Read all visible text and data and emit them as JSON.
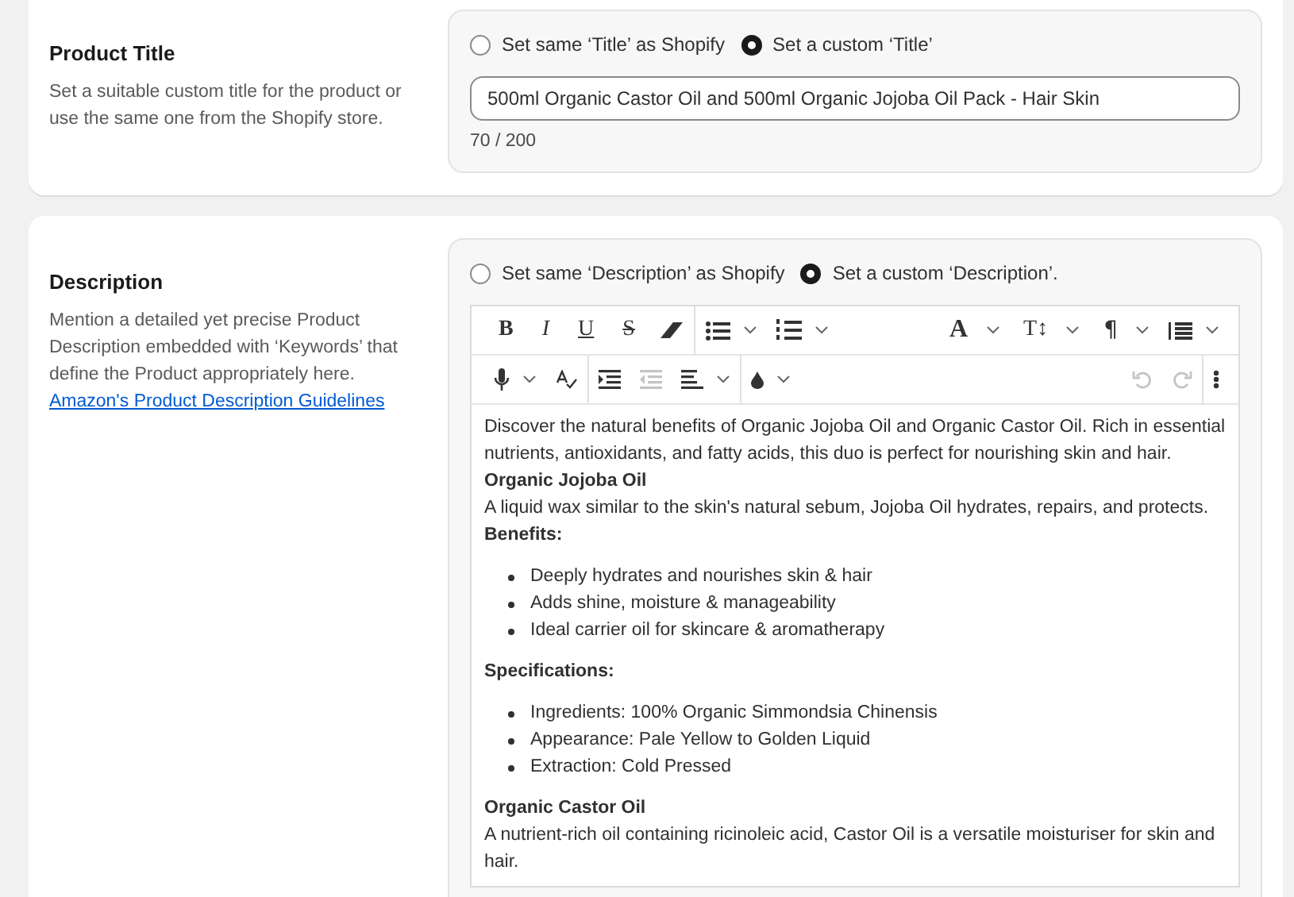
{
  "title_section": {
    "heading": "Product Title",
    "help": "Set a suitable custom title for the product or use the same one from the Shopify store.",
    "options": [
      {
        "label": "Set same ‘Title’ as Shopify",
        "selected": false
      },
      {
        "label": "Set a custom ‘Title’",
        "selected": true
      }
    ],
    "value": "500ml Organic Castor Oil and 500ml Organic Jojoba Oil Pack - Hair Skin",
    "counter": "70 / 200"
  },
  "description_section": {
    "heading": "Description",
    "help": "Mention a detailed yet precise Product Description embedded with ‘Keywords’ that define the Product appropriately here.",
    "link": "Amazon's Product Description Guidelines",
    "options": [
      {
        "label": "Set same ‘Description’ as Shopify",
        "selected": false
      },
      {
        "label": "Set a custom ‘Description’.",
        "selected": true
      }
    ],
    "toolbar": {
      "bold": "B",
      "italic": "I",
      "underline": "U",
      "strikethrough": "S",
      "font_color": "A",
      "font_size": "T↕",
      "paragraph": "¶",
      "outdent_disabled": true,
      "undo_disabled": true,
      "redo_disabled": true
    },
    "content": [
      {
        "kind": "p",
        "text": "Discover the natural benefits of Organic Jojoba Oil and Organic Castor Oil. Rich in essential nutrients, antioxidants, and fatty acids, this duo is perfect for nourishing skin and hair."
      },
      {
        "kind": "h",
        "text": "Organic Jojoba Oil"
      },
      {
        "kind": "p",
        "text": "A liquid wax similar to the skin's natural sebum, Jojoba Oil hydrates, repairs, and protects."
      },
      {
        "kind": "h",
        "text": "Benefits:"
      },
      {
        "kind": "ul",
        "items": [
          "Deeply hydrates and nourishes skin & hair",
          "Adds shine, moisture & manageability",
          "Ideal carrier oil for skincare & aromatherapy"
        ]
      },
      {
        "kind": "h",
        "text": "Specifications:"
      },
      {
        "kind": "ul",
        "items": [
          "Ingredients: 100% Organic Simmondsia Chinensis",
          "Appearance: Pale Yellow to Golden Liquid",
          "Extraction: Cold Pressed"
        ]
      },
      {
        "kind": "h",
        "text": "Organic Castor Oil"
      },
      {
        "kind": "p",
        "text": "A nutrient-rich oil containing ricinoleic acid, Castor Oil is a versatile moisturiser for skin and hair."
      }
    ]
  }
}
